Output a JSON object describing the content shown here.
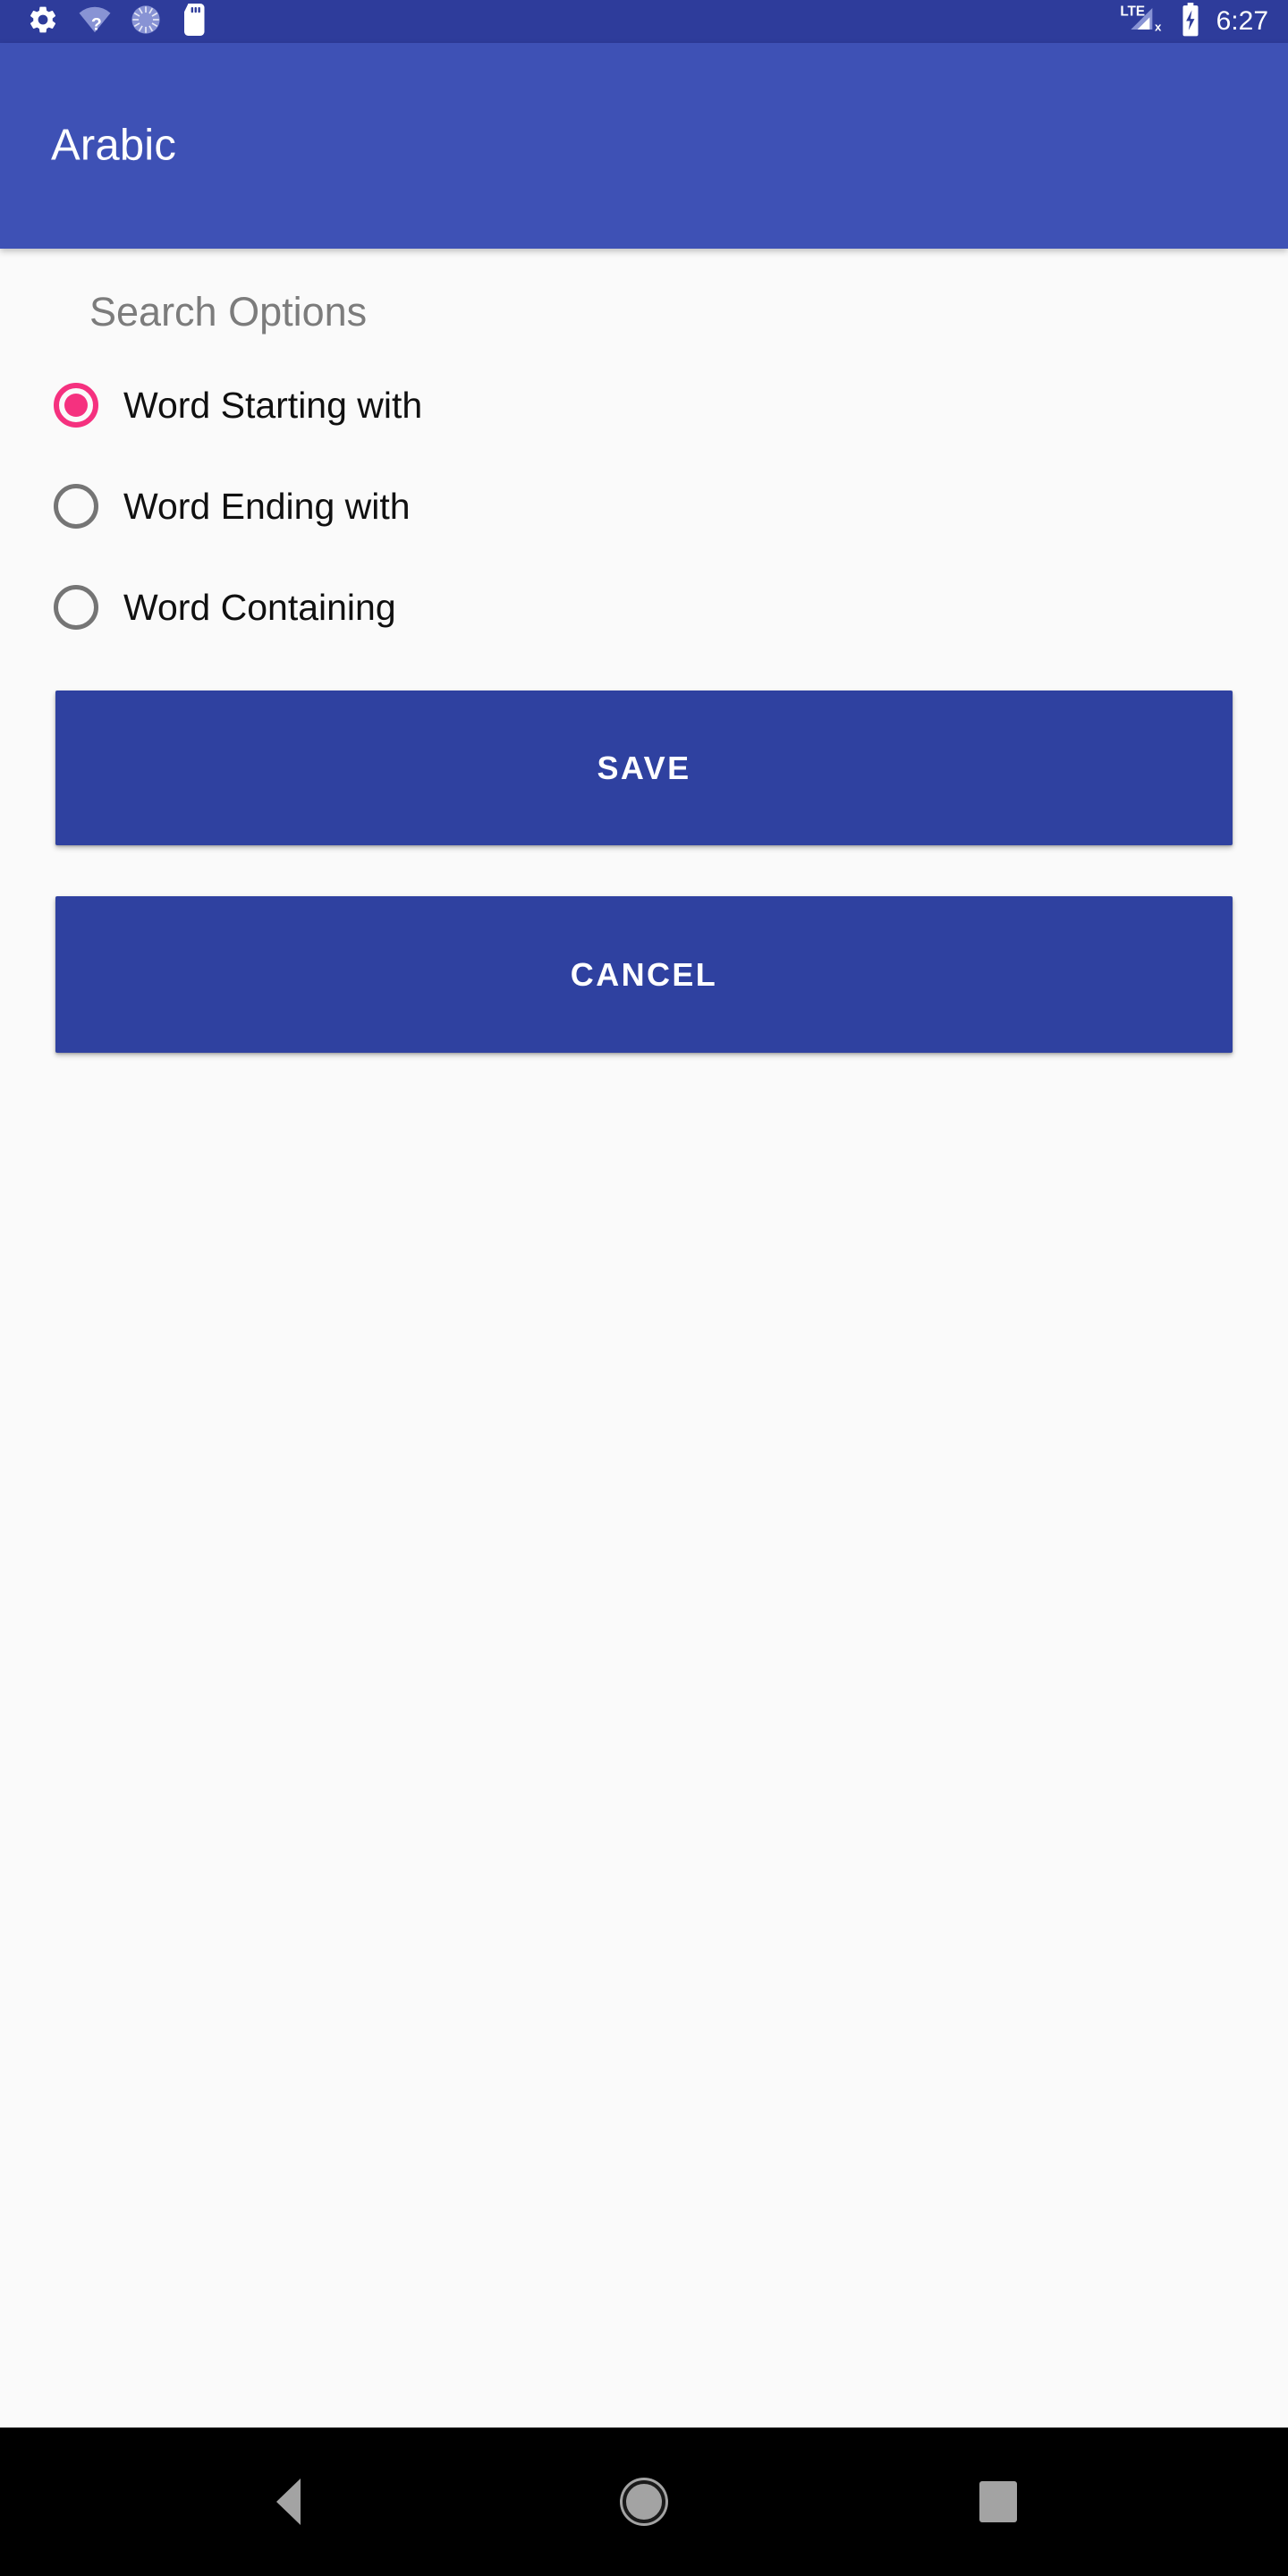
{
  "status_bar": {
    "background": "#2E3C9B",
    "left_icons": [
      {
        "name": "settings-gear-icon",
        "label": "Settings"
      },
      {
        "name": "wifi-unknown-icon",
        "label": "Wi-Fi no internet"
      },
      {
        "name": "sync-progress-icon",
        "label": "Sync"
      },
      {
        "name": "sd-card-icon",
        "label": "SD card"
      }
    ],
    "right_icons": [
      {
        "name": "lte-signal-icon",
        "label": "LTE"
      },
      {
        "name": "battery-charging-icon",
        "label": "Battery charging"
      }
    ],
    "network_label": "LTE",
    "signal_no_service_mark": "x",
    "clock": "6:27"
  },
  "app_bar": {
    "title": "Arabic",
    "background": "#3E51B5",
    "text_color": "#FFFFFF"
  },
  "content": {
    "background": "#FAFAFA",
    "section_title": "Search Options",
    "section_title_color": "#7C7C7C",
    "radio_group": {
      "name": "search-options",
      "selected_index": 0,
      "selected_color": "#F5317F",
      "unselected_color": "#757575",
      "options": [
        {
          "label": "Word Starting with",
          "selected": true
        },
        {
          "label": "Word Ending with",
          "selected": false
        },
        {
          "label": "Word Containing",
          "selected": false
        }
      ]
    },
    "buttons": {
      "background": "#2F41A0",
      "text_color": "#FFFFFF",
      "save_label": "SAVE",
      "cancel_label": "CANCEL"
    }
  },
  "navigation_bar": {
    "background": "#000000",
    "icon_color": "#A3A3A3",
    "items": [
      {
        "name": "nav-back-icon",
        "label": "Back"
      },
      {
        "name": "nav-home-icon",
        "label": "Home"
      },
      {
        "name": "nav-recents-icon",
        "label": "Recents"
      }
    ]
  }
}
